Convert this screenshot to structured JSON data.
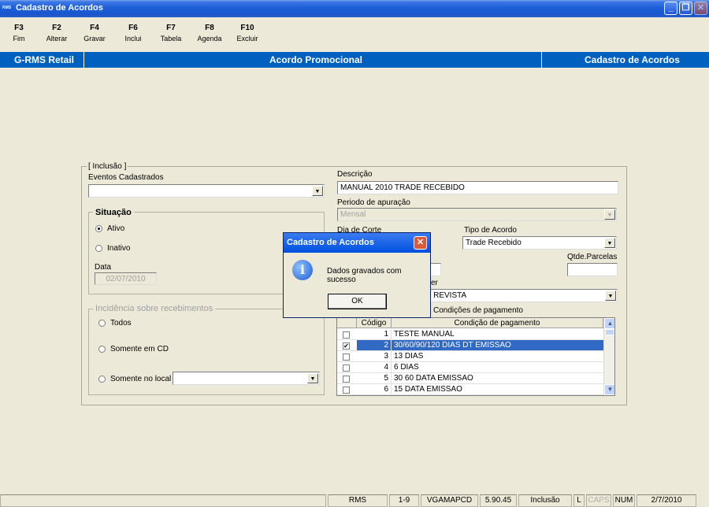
{
  "window": {
    "title": "Cadastro de Acordos",
    "app_icon_text": "RMS"
  },
  "toolbar": [
    {
      "key": "F3",
      "label": "Fim"
    },
    {
      "key": "F2",
      "label": "Alterar"
    },
    {
      "key": "F4",
      "label": "Gravar"
    },
    {
      "key": "F6",
      "label": "Inclui"
    },
    {
      "key": "F7",
      "label": "Tabela"
    },
    {
      "key": "F8",
      "label": "Agenda"
    },
    {
      "key": "F10",
      "label": "Excluir"
    }
  ],
  "header": {
    "left": "G-RMS Retail",
    "center": "Acordo Promocional",
    "right": "Cadastro de Acordos"
  },
  "form": {
    "mode": "[ Inclusão ]",
    "eventos_label": "Eventos Cadastrados",
    "eventos_value": "",
    "situacao_title": "Situação",
    "ativo_label": "Ativo",
    "inativo_label": "Inativo",
    "data_label": "Data",
    "data_value": "02/07/2010",
    "incidencia_title": "Incidência sobre recebimentos",
    "todos_label": "Todos",
    "somente_cd_label": "Somente em CD",
    "somente_local_label": "Somente no local",
    "somente_local_value": "",
    "descricao_label": "Descrição",
    "descricao_value": "MANUAL 2010 TRADE RECEBIDO",
    "periodo_label": "Periodo de apuração",
    "periodo_value": "Mensal",
    "dia_corte_label": "Dia de Corte",
    "tipo_acordo_label": "Tipo de Acordo",
    "tipo_acordo_value": "Trade Recebido",
    "qtde_parcelas_label": "Qtde.Parcelas",
    "qtde_parcelas_value": "",
    "partial_label_suffix": "er",
    "partial_combo_value": "- REVISTA",
    "cond_pag_title": "Condições de pagamento"
  },
  "grid": {
    "headers": {
      "code": "Código",
      "name": "Condição de pagamento"
    },
    "rows": [
      {
        "checked": false,
        "selected": false,
        "code": "1",
        "name": "TESTE MANUAL"
      },
      {
        "checked": true,
        "selected": true,
        "code": "2",
        "name": "30/60/90/120 DIAS DT EMISSAO"
      },
      {
        "checked": false,
        "selected": false,
        "code": "3",
        "name": "13 DIAS"
      },
      {
        "checked": false,
        "selected": false,
        "code": "4",
        "name": "6 DIAS"
      },
      {
        "checked": false,
        "selected": false,
        "code": "5",
        "name": "30 60 DATA EMISSAO"
      },
      {
        "checked": false,
        "selected": false,
        "code": "6",
        "name": "15 DATA EMISSAO"
      }
    ]
  },
  "dialog": {
    "title": "Cadastro de Acordos",
    "message": "Dados gravados com sucesso",
    "ok_label": "OK",
    "icon": "info-icon"
  },
  "status": {
    "app": "RMS",
    "range": "1-9",
    "user": "VGAMAPCD",
    "version": "5.90.45",
    "mode": "Inclusão",
    "l": "L",
    "caps": "CAPS",
    "num": "NUM",
    "date": "2/7/2010"
  },
  "colors": {
    "header_bar": "#0060c0",
    "selection": "#316ac5",
    "titlebar": "#1d5fd8"
  }
}
